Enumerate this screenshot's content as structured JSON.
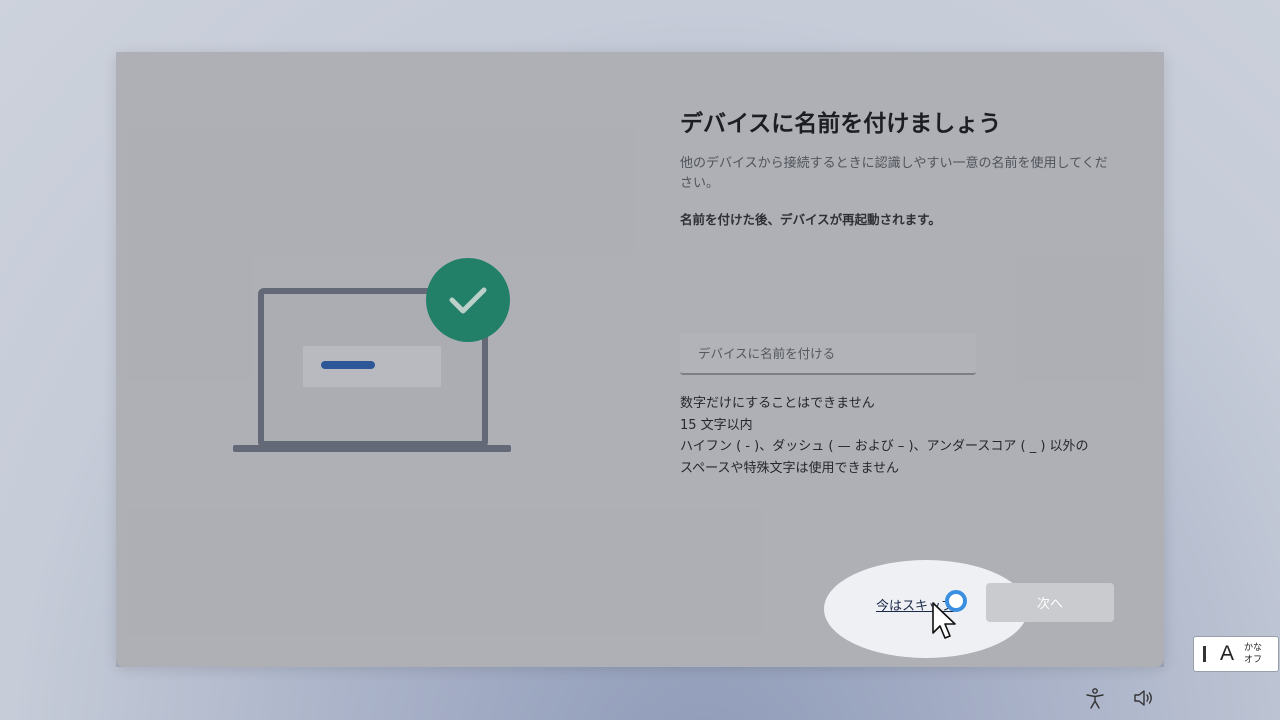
{
  "page": {
    "title": "デバイスに名前を付けましょう",
    "subtitle": "他のデバイスから接続するときに認識しやすい一意の名前を使用してください。",
    "notice": "名前を付けた後、デバイスが再起動されます。"
  },
  "name_input": {
    "placeholder": "デバイスに名前を付ける",
    "value": ""
  },
  "rules": [
    "数字だけにすることはできません",
    "15 文字以内",
    "ハイフン ( - )、ダッシュ ( — および – )、アンダースコア ( _ ) 以外の",
    "スペースや特殊文字は使用できません"
  ],
  "actions": {
    "skip_label": "今はスキップ",
    "next_label": "次へ"
  },
  "ime": {
    "mode_letter": "A",
    "kana_line1": "かな",
    "kana_line2": "オフ"
  },
  "taskbar": {
    "accessibility_icon": "accessibility-icon",
    "volume_icon": "volume-icon"
  },
  "colors": {
    "check_badge": "#1e8e6e",
    "input_bar": "#2a5ca8",
    "focus_ring": "#3a8fe0"
  }
}
